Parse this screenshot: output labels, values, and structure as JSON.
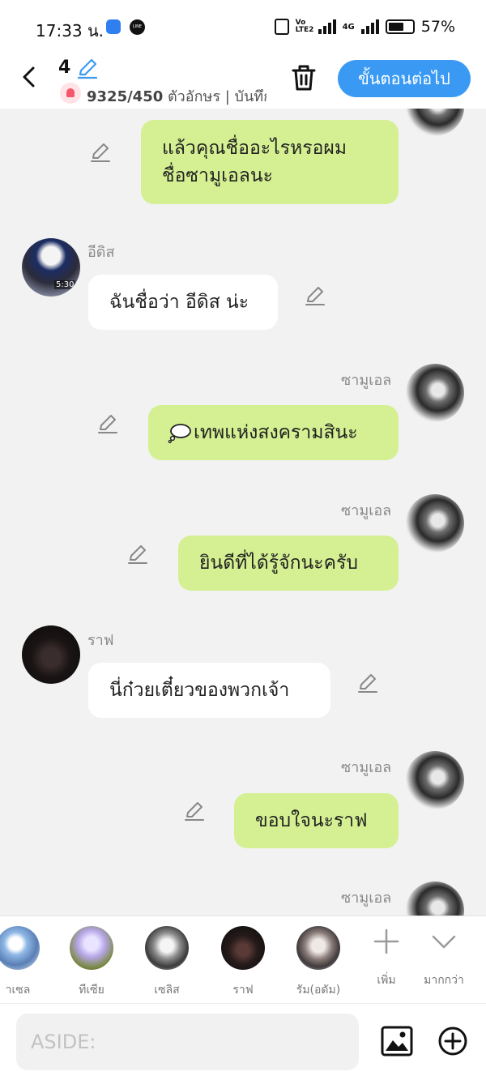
{
  "status_bar": {
    "time": "17:33 น.",
    "battery": "57%",
    "volte": "Vo LTE2",
    "network": "4G"
  },
  "header": {
    "episode": "4",
    "char_count": "9325/450",
    "char_count_suffix": " ตัวอักษร | บันทึก",
    "next_label": "ขั้นตอนต่อไป"
  },
  "messages": [
    {
      "side": "right",
      "speaker": "",
      "lines": [
        "แล้วคุณชื่ออะไรหรอผม",
        "ชื่อซามูเอลนะ"
      ]
    },
    {
      "side": "left",
      "speaker": "อีดิส",
      "text": "ฉันชื่อว่า อีดิส น่ะ",
      "avatar_badge": "5:30"
    },
    {
      "side": "right",
      "speaker": "ซามูเอล",
      "text": "เทพแห่งสงครามสินะ",
      "thought": true
    },
    {
      "side": "right",
      "speaker": "ซามูเอล",
      "text": "ยินดีที่ได้รู้จักนะครับ"
    },
    {
      "side": "left",
      "speaker": "ราฟ",
      "text": "นี่ก๋วยเตี๋ยวของพวกเจ้า"
    },
    {
      "side": "right",
      "speaker": "ซามูเอล",
      "text": "ขอบใจนะราฟ"
    },
    {
      "side": "right",
      "speaker": "ซามูเอล",
      "text": ""
    }
  ],
  "characters": [
    {
      "name": "าเซล"
    },
    {
      "name": "ทีเซีย"
    },
    {
      "name": "เซลิส"
    },
    {
      "name": "ราฟ"
    },
    {
      "name": "รัม(อดัม)"
    }
  ],
  "character_actions": {
    "add_label": "เพิ่ม",
    "more_label": "มากกว่า"
  },
  "input": {
    "placeholder": "ASIDE:",
    "value": ""
  },
  "colors": {
    "accent": "#3a9af3",
    "my_bubble": "#d4f092",
    "other_bubble": "#ffffff",
    "background": "#f2f2f2"
  }
}
